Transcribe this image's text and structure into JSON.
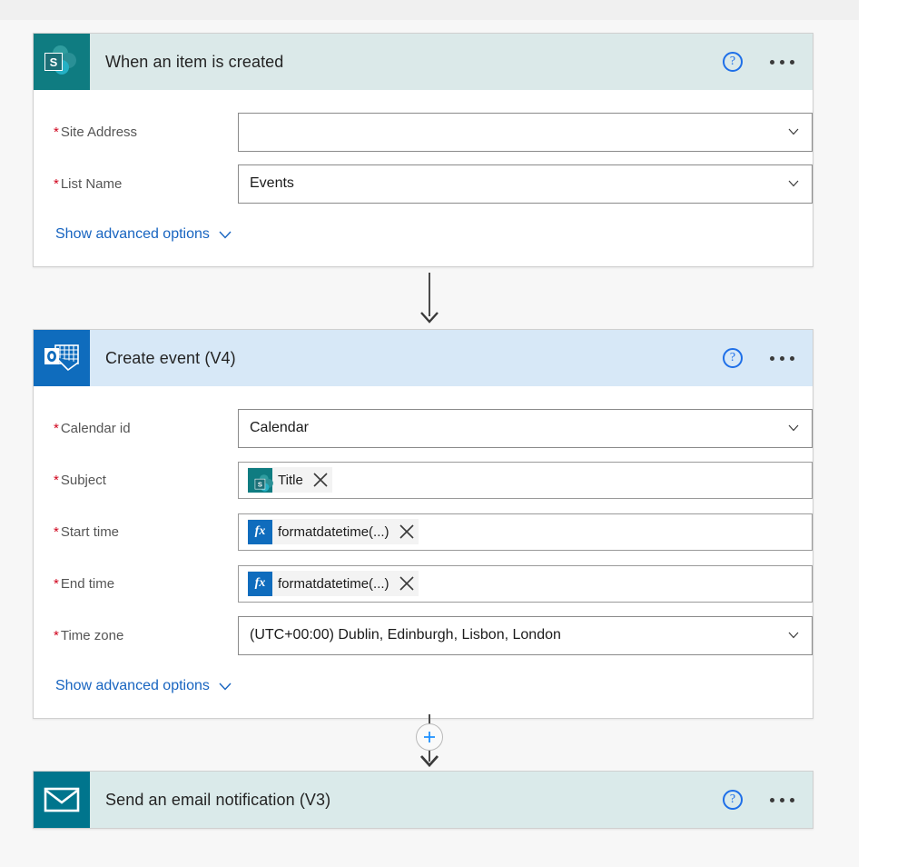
{
  "flow": {
    "steps": [
      {
        "id": "when-an-item-is-created",
        "title": "When an item is created",
        "icon": "sharepoint-icon",
        "header_color": "#dbe9e9",
        "icon_color": "#0f7c81",
        "help_label": "?",
        "fields": [
          {
            "label": "Site Address",
            "required": true,
            "type": "combobox",
            "value": "",
            "placeholder": ""
          },
          {
            "label": "List Name",
            "required": true,
            "type": "combobox",
            "value": "Events",
            "placeholder": ""
          }
        ],
        "advanced_label": "Show advanced options"
      },
      {
        "id": "create-event-v4",
        "title": "Create event (V4)",
        "icon": "outlook-calendar-icon",
        "header_color": "#d7e8f7",
        "icon_color": "#0f6cbd",
        "help_label": "?",
        "fields": [
          {
            "label": "Calendar id",
            "required": true,
            "type": "combobox",
            "value": "Calendar",
            "placeholder": ""
          },
          {
            "label": "Subject",
            "required": true,
            "type": "tokenbox",
            "token": {
              "icon": "sharepoint-icon",
              "text": "Title"
            }
          },
          {
            "label": "Start time",
            "required": true,
            "type": "tokenbox",
            "token": {
              "icon": "fx-icon",
              "text": "formatdatetime(...)"
            }
          },
          {
            "label": "End time",
            "required": true,
            "type": "tokenbox",
            "token": {
              "icon": "fx-icon",
              "text": "formatdatetime(...)"
            }
          },
          {
            "label": "Time zone",
            "required": true,
            "type": "combobox",
            "value": "(UTC+00:00) Dublin, Edinburgh, Lisbon, London",
            "placeholder": ""
          }
        ],
        "advanced_label": "Show advanced options"
      },
      {
        "id": "send-an-email-notification-v3",
        "title": "Send an email notification (V3)",
        "icon": "envelope-icon",
        "header_color": "#daeaea",
        "icon_color": "#00758d",
        "help_label": "?",
        "fields": [],
        "advanced_label": ""
      }
    ],
    "add_step_label": "+",
    "colors": {
      "required_asterisk": "#d0021b",
      "link": "#1764c0",
      "help": "#1e6fe8",
      "fx_token": "#0f6cbd",
      "plus": "#1e90ff",
      "canvas": "#f7f7f7"
    }
  }
}
